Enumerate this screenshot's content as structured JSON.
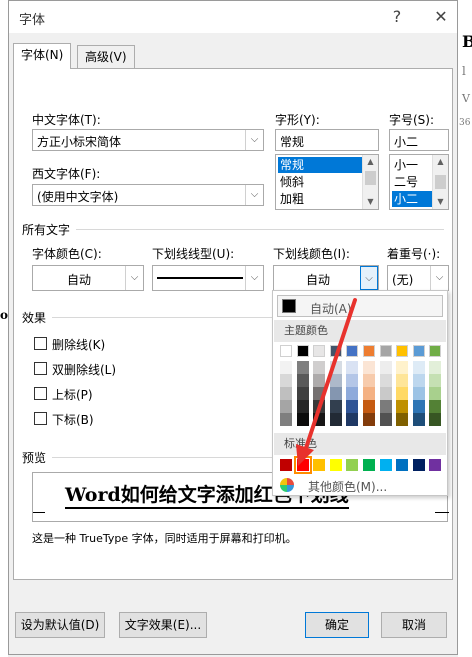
{
  "window": {
    "title": "字体",
    "help_glyph": "?",
    "close_glyph": "✕"
  },
  "tabs": [
    {
      "label": "字体(N)"
    },
    {
      "label": "高级(V)"
    }
  ],
  "font": {
    "chinese_label": "中文字体(T):",
    "chinese_value": "方正小标宋简体",
    "western_label": "西文字体(F):",
    "western_value": "(使用中文字体)",
    "style_label": "字形(Y):",
    "style_value": "常规",
    "style_options": [
      "常规",
      "倾斜",
      "加粗"
    ],
    "size_label": "字号(S):",
    "size_value": "小二",
    "size_options": [
      "小一",
      "二号",
      "小二"
    ]
  },
  "all_text": {
    "section_label": "所有文字",
    "color_label": "字体颜色(C):",
    "color_value": "自动",
    "underline_style_label": "下划线线型(U):",
    "underline_color_label": "下划线颜色(I):",
    "underline_color_value": "自动",
    "emphasis_label": "着重号(·):",
    "emphasis_value": "(无)"
  },
  "effects": {
    "section_label": "效果",
    "items": [
      {
        "label": "删除线(K)"
      },
      {
        "label": "双删除线(L)"
      },
      {
        "label": "上标(P)"
      },
      {
        "label": "下标(B)"
      }
    ]
  },
  "preview": {
    "section_label": "预览",
    "sample_text": "Word如何给文字添加红色下划线",
    "description": "这是一种 TrueType 字体，同时适用于屏幕和打印机。"
  },
  "buttons": {
    "set_default": "设为默认值(D)",
    "text_effects": "文字效果(E)...",
    "ok": "确定",
    "cancel": "取消"
  },
  "color_popup": {
    "auto_label": "自动(A)",
    "theme_label": "主题颜色",
    "standard_label": "标准色",
    "more_label": "其他颜色(M)...",
    "theme_top": [
      "#ffffff",
      "#000000",
      "#e7e6e6",
      "#44546a",
      "#4472c4",
      "#ed7d31",
      "#a5a5a5",
      "#ffc000",
      "#5b9bd5",
      "#70ad47"
    ],
    "theme_shades": [
      [
        "#f2f2f2",
        "#7f7f7f",
        "#d0cece",
        "#d6dce4",
        "#d9e2f3",
        "#fbe5d5",
        "#ededed",
        "#fff2cc",
        "#deebf6",
        "#e2efd9"
      ],
      [
        "#d8d8d8",
        "#595959",
        "#aeabab",
        "#adb9ca",
        "#b4c6e7",
        "#f7cbac",
        "#dbdbdb",
        "#fee599",
        "#bdd7ee",
        "#c5e0b3"
      ],
      [
        "#bfbfbf",
        "#3f3f3f",
        "#757070",
        "#8496b0",
        "#8eaadb",
        "#f4b183",
        "#c9c9c9",
        "#ffd965",
        "#9cc3e5",
        "#a8d08d"
      ],
      [
        "#a5a5a5",
        "#262626",
        "#3a3838",
        "#323f4f",
        "#2f5496",
        "#c55a11",
        "#7b7b7b",
        "#bf9000",
        "#2e75b5",
        "#538135"
      ],
      [
        "#7f7f7f",
        "#0c0c0c",
        "#171616",
        "#222a35",
        "#1f3864",
        "#833c0b",
        "#525252",
        "#7f6000",
        "#1e4e79",
        "#375623"
      ]
    ],
    "standard": [
      "#c00000",
      "#ff0000",
      "#ffc000",
      "#ffff00",
      "#92d050",
      "#00b050",
      "#00b0f0",
      "#0070c0",
      "#002060",
      "#7030a0"
    ]
  },
  "background_page": {
    "right_edge_chars": [
      "B",
      "l",
      "V",
      "36"
    ],
    "left_edge_char": "o"
  },
  "accent_colors": {
    "arrow": "#e8322d",
    "selection": "#0078d7"
  }
}
